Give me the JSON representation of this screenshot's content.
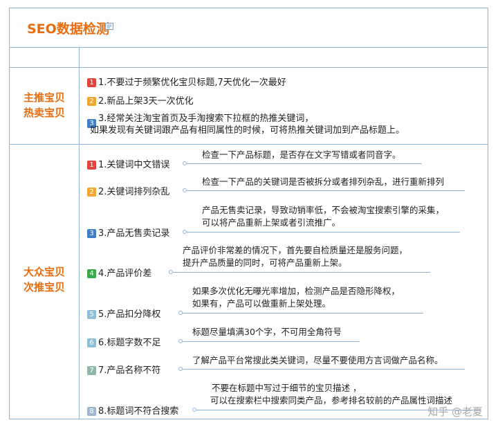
{
  "title": "SEO数据检测",
  "icons": {
    "note": "note-icon"
  },
  "colors": {
    "accent": "#e86d10",
    "border": "#8fb4dc"
  },
  "sections": [
    {
      "label_lines": [
        "主推宝贝",
        "热卖宝贝"
      ],
      "items": [
        {
          "num": "1",
          "color": "#e0453d",
          "text": "1.不要过于频繁优化宝贝标题,7天优化一次最好"
        },
        {
          "num": "2",
          "color": "#f1a630",
          "text": "2.新品上架3天一次优化"
        },
        {
          "num": "3",
          "color": "#3f7fc9",
          "lines": [
            "3.经常关注淘宝首页及手淘搜索下拉框的热推关键词，",
            "如果发现有关键词跟产品有相同属性的时候，可将热推关键词加到产品标题上。"
          ]
        }
      ]
    },
    {
      "label_lines": [
        "大众宝贝",
        "次推宝贝"
      ],
      "items": [
        {
          "num": "1",
          "color": "#e0453d",
          "title": "1.关键词中文错误",
          "desc": [
            "检查一下产品标题，是否存在文字写错或者同音字。"
          ]
        },
        {
          "num": "2",
          "color": "#f1a630",
          "title": "2.关键词排列杂乱",
          "desc": [
            "检查一下产品的关键词是否被拆分或者排列杂乱，进行重新排列"
          ]
        },
        {
          "num": "3",
          "color": "#3f7fc9",
          "title": "3.产品无售卖记录",
          "desc": [
            "产品无售卖记录，导致动销率低，不会被淘宝搜索引擎的采集，",
            "可以将产品重新上架或者引流推广。"
          ]
        },
        {
          "num": "4",
          "color": "#3aa84a",
          "title": "4.产品评价差",
          "desc": [
            "产品评价非常差的情况下，首先要自检质量还是服务问题，",
            "提升产品质量的同时，可将产品重新上架。"
          ]
        },
        {
          "num": "5",
          "color": "#8fbfd6",
          "title": "5.产品扣分降权",
          "desc": [
            "如果多次优化无曝光率增加，检测产品是否隐形降权，",
            "如果有，产品可以做重新上架处理。"
          ]
        },
        {
          "num": "6",
          "color": "#8fbfd6",
          "title": "6.标题字数不足",
          "desc": [
            "标题尽量填满30个字，不可用全角符号"
          ]
        },
        {
          "num": "7",
          "color": "#8fb8a8",
          "title": "7.产品名称不符",
          "desc": [
            "了解产品平台常搜此类关键词，尽量不要使用方言词做产品名称。"
          ]
        },
        {
          "num": "8",
          "color": "#a0b8cf",
          "title": "8.标题词不符合搜索",
          "desc": [
            "不要在标题中写过于细节的宝贝描述 ，",
            "可以在搜索栏中搜索同类产品，参考排名较前的产品属性词描述"
          ]
        }
      ]
    }
  ],
  "watermark": "知乎 @老夏"
}
